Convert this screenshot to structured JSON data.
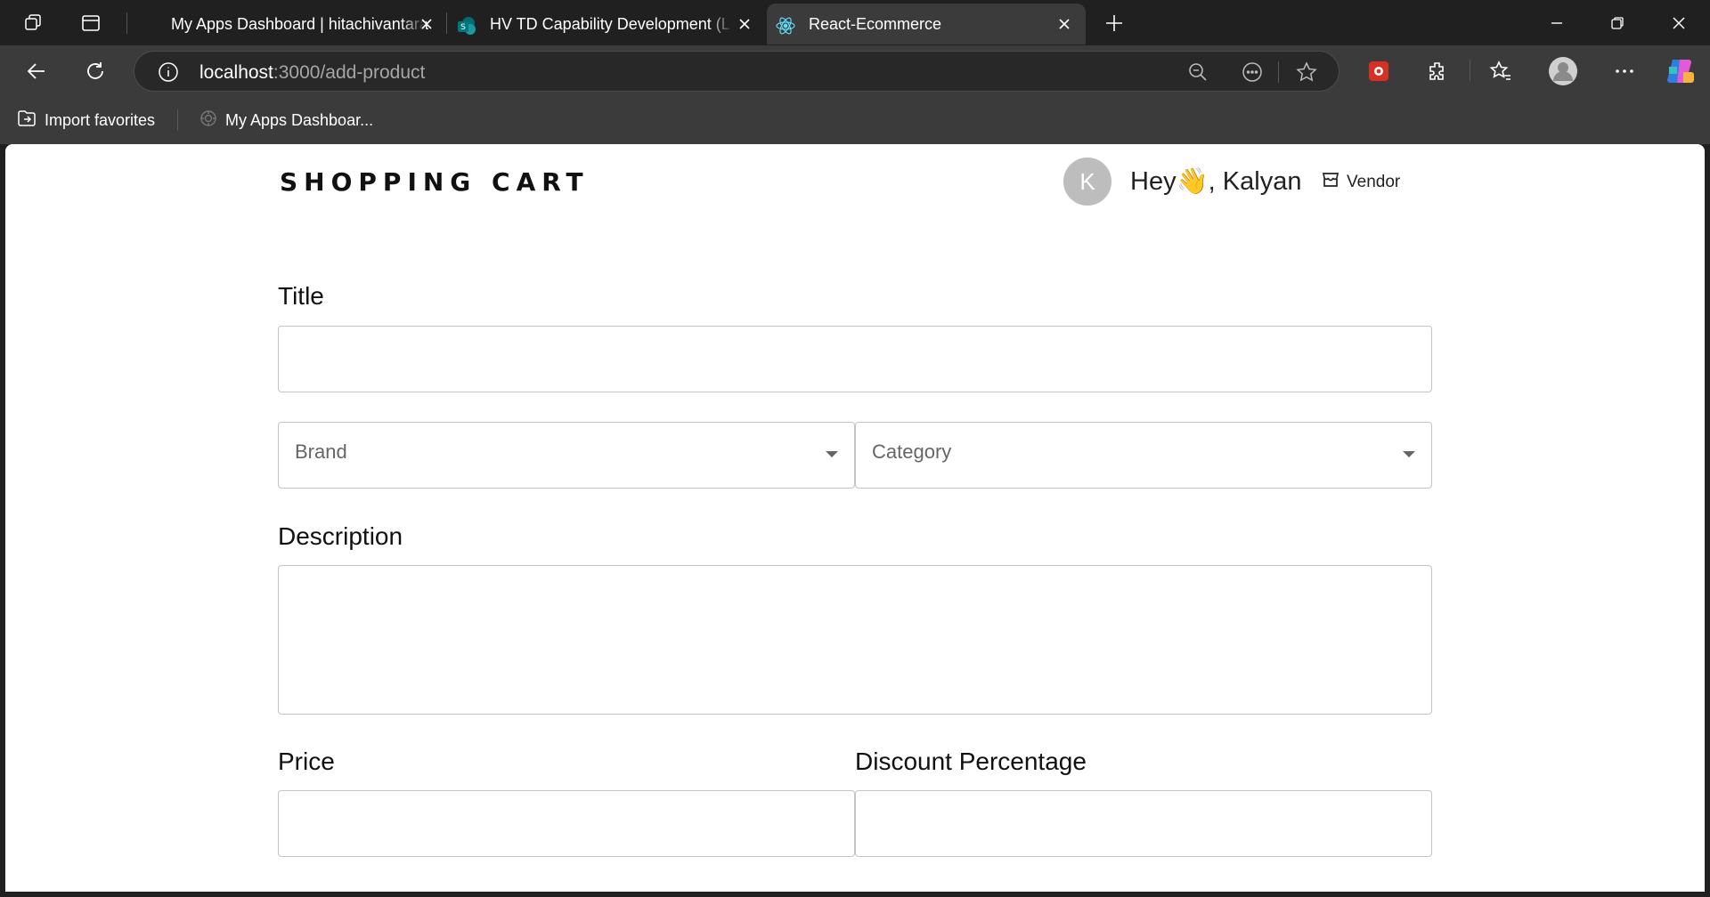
{
  "browser": {
    "tabs": [
      {
        "title": "My Apps Dashboard | hitachivantara",
        "active": false
      },
      {
        "title": "HV TD Capability Development (L...",
        "active": false
      },
      {
        "title": "React-Ecommerce",
        "active": true
      }
    ],
    "address_bar": {
      "host": "localhost",
      "path": ":3000/add-product"
    },
    "favorites": [
      {
        "label": "Import favorites",
        "icon": "import-favorites-icon"
      },
      {
        "label": "My Apps Dashboar...",
        "icon": "globe-icon"
      }
    ]
  },
  "app": {
    "logo": "SHOPPING CART",
    "user": {
      "avatar_initial": "K",
      "greeting": "Hey👋, Kalyan"
    },
    "vendor_link": "Vendor",
    "form": {
      "title_label": "Title",
      "title_value": "",
      "brand_placeholder": "Brand",
      "category_placeholder": "Category",
      "description_label": "Description",
      "description_value": "",
      "price_label": "Price",
      "price_value": "",
      "discount_label": "Discount Percentage",
      "discount_value": ""
    }
  },
  "colors": {
    "browser_chrome": "#202020",
    "toolbar": "#3b3b3b",
    "avatar_bg": "#bdbdbd",
    "field_border": "#c4c4c4"
  }
}
